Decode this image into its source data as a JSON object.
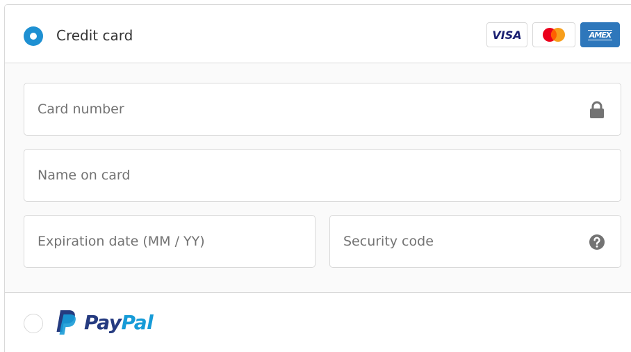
{
  "payment_methods": {
    "credit_card": {
      "label": "Credit card",
      "selected": true,
      "brands": {
        "visa": "VISA",
        "mastercard_icon": "mastercard-logo-icon",
        "amex": "AMEX"
      },
      "fields": {
        "card_number": {
          "placeholder": "Card number",
          "value": "",
          "icon": "lock-icon"
        },
        "name_on_card": {
          "placeholder": "Name on card",
          "value": ""
        },
        "expiration": {
          "placeholder": "Expiration date (MM / YY)",
          "value": ""
        },
        "security_code": {
          "placeholder": "Security code",
          "value": "",
          "icon": "question-circle-icon"
        }
      }
    },
    "paypal": {
      "selected": false,
      "logo_pay": "Pay",
      "logo_pal": "Pal"
    }
  },
  "colors": {
    "accent": "#1e90d2",
    "border": "#d9d9d9",
    "form_background": "#fafafa",
    "paypal_dark": "#253b80",
    "paypal_light": "#179bd7",
    "amex_blue": "#2e77bb"
  }
}
